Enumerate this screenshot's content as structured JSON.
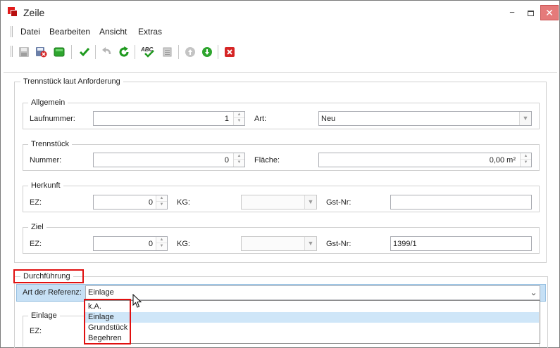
{
  "window": {
    "title": "Zeile"
  },
  "menu": [
    "Datei",
    "Bearbeiten",
    "Ansicht",
    "Extras"
  ],
  "toolbar": {
    "buttons": [
      "save-disabled-icon",
      "save-close-icon",
      "new-green-icon",
      "check-icon",
      "undo-icon",
      "refresh-icon",
      "spellcheck-icon",
      "print-icon",
      "up-icon",
      "down-icon",
      "delete-icon"
    ]
  },
  "main": {
    "section_title": "Trennstück laut Anforderung",
    "allgemein": {
      "legend": "Allgemein",
      "laufnummer_label": "Laufnummer:",
      "laufnummer_value": "1",
      "art_label": "Art:",
      "art_value": "Neu"
    },
    "trennstueck": {
      "legend": "Trennstück",
      "nummer_label": "Nummer:",
      "nummer_value": "0",
      "flaeche_label": "Fläche:",
      "flaeche_value": "0,00 m²"
    },
    "herkunft": {
      "legend": "Herkunft",
      "ez_label": "EZ:",
      "ez_value": "0",
      "kg_label": "KG:",
      "kg_value": "",
      "gst_label": "Gst-Nr:",
      "gst_value": ""
    },
    "ziel": {
      "legend": "Ziel",
      "ez_label": "EZ:",
      "ez_value": "0",
      "kg_label": "KG:",
      "kg_value": "",
      "gst_label": "Gst-Nr:",
      "gst_value": "1399/1"
    }
  },
  "durchfuehrung": {
    "legend": "Durchführung",
    "art_referenz_label": "Art der Referenz:",
    "art_referenz_value": "Einlage",
    "options": [
      "k.A.",
      "Einlage",
      "Grundstück",
      "Begehren"
    ],
    "selected_index": 1,
    "einlage": {
      "legend": "Einlage",
      "ez_label": "EZ:"
    }
  },
  "colors": {
    "highlight": "#c6e0f5",
    "annotation_red": "#e01010",
    "close_button": "#e57a7a"
  }
}
